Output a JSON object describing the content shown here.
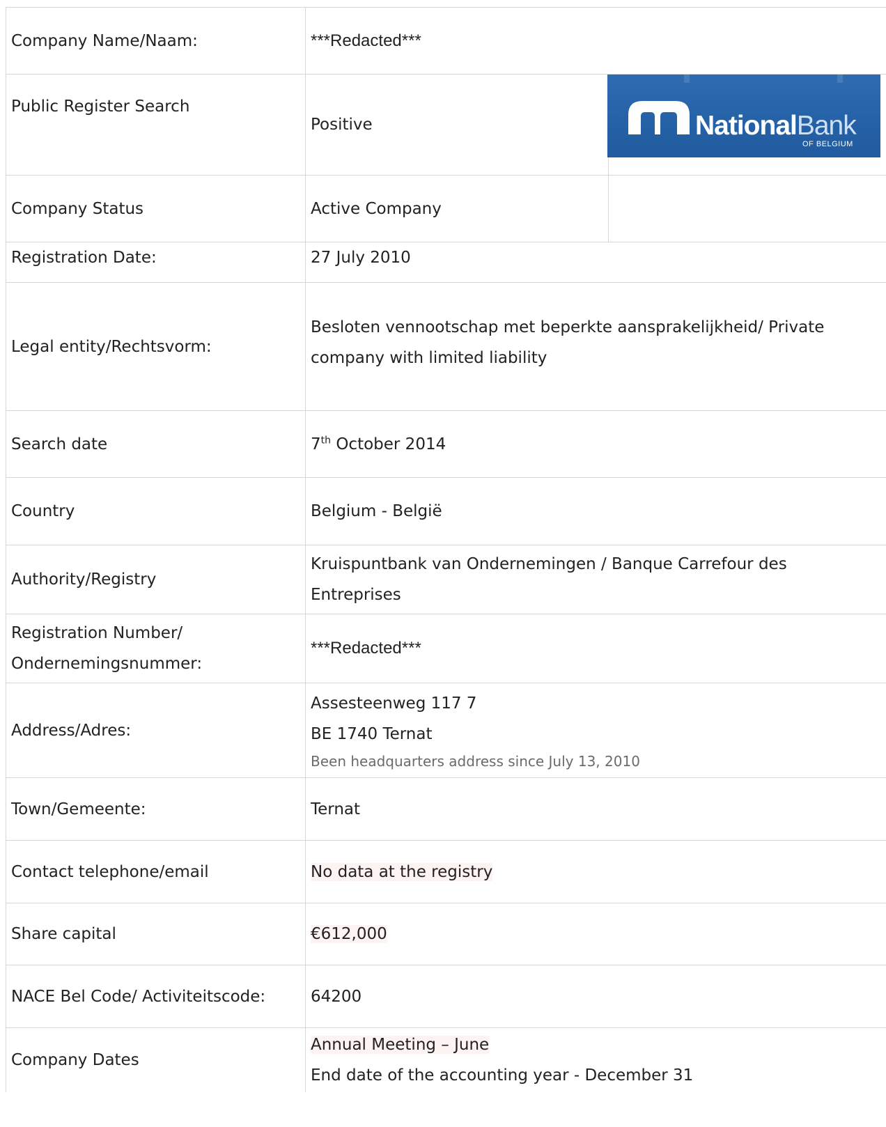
{
  "rows": [
    {
      "label": "Company Name/Naam:",
      "value": "***Redacted***"
    },
    {
      "label": "Public Register Search",
      "value": "Positive"
    },
    {
      "label": "Company Status",
      "value": "Active Company"
    },
    {
      "label": "Registration Date:",
      "value": "27 July 2010"
    },
    {
      "label": "Legal entity/Rechtsvorm:",
      "value_line1": "Besloten vennootschap met beperkte aansprakelijkheid/ Private",
      "value_line2": "company with limited liability"
    },
    {
      "label": "Search date",
      "value_day": "7",
      "value_sup": "th",
      "value_rest": " October 2014"
    },
    {
      "label": "Country",
      "value": "Belgium - België"
    },
    {
      "label": "Authority/Registry",
      "value_line1": "Kruispuntbank van Ondernemingen / Banque Carrefour des",
      "value_line2": "Entreprises"
    },
    {
      "label_line1": "Registration Number/",
      "label_line2": "Ondernemingsnummer:",
      "value": "***Redacted***"
    },
    {
      "label": "Address/Adres:",
      "value_line1": "Assesteenweg 117 7",
      "value_line2": "BE 1740 Ternat",
      "note": "Been headquarters address since July 13, 2010"
    },
    {
      "label": "Town/Gemeente:",
      "value": "Ternat"
    },
    {
      "label": "Contact telephone/email",
      "value": "No data at the registry"
    },
    {
      "label": "Share capital",
      "value": "€612,000"
    },
    {
      "label": "NACE Bel Code/ Activiteitscode:",
      "value": "64200"
    },
    {
      "label": "Company Dates",
      "value_line1": "Annual Meeting – June",
      "value_line2": "End date of the accounting year - December 31"
    }
  ],
  "logo": {
    "word_bold": "National",
    "word_light": "Bank",
    "sub": "OF BELGIUM",
    "bg_color": "#2561a6"
  }
}
